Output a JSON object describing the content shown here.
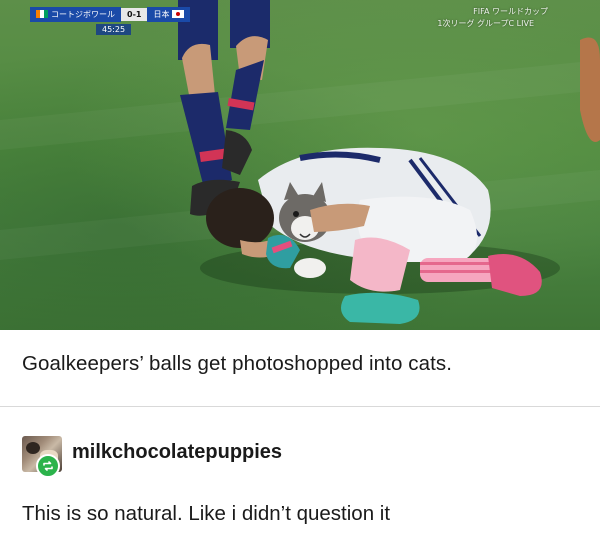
{
  "photo": {
    "alt_description_shown": "",
    "broadcast": {
      "team_left": "コートジボワール",
      "score": "0-1",
      "team_right": "日本",
      "clock": "45:25",
      "tournament": "FIFA ワールドカップ",
      "round": "1次リーグ グループC LIVE"
    }
  },
  "post": {
    "caption": "Goalkeepers’ balls get photoshopped into cats."
  },
  "reblog": {
    "username": "milkchocolatepuppies",
    "comment": "This is so natural. Like i didn’t question it"
  },
  "colors": {
    "reblog_badge": "#2bb34b",
    "text": "#1a1a1a",
    "divider": "#d9d9d9"
  },
  "icons": {
    "reblog": "reblog-icon"
  }
}
